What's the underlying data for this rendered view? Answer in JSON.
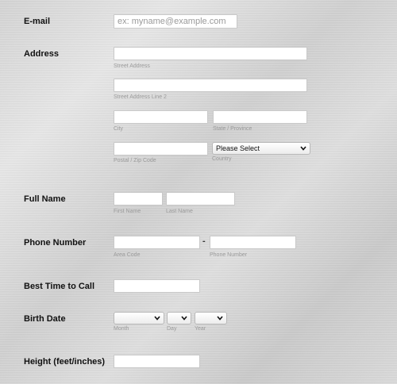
{
  "email": {
    "label": "E-mail",
    "placeholder": "ex: myname@example.com"
  },
  "address": {
    "label": "Address",
    "street_label": "Street Address",
    "street2_label": "Street Address Line 2",
    "city_label": "City",
    "state_label": "State / Province",
    "postal_label": "Postal / Zip Code",
    "country_label": "Country",
    "country_value": "Please Select"
  },
  "full_name": {
    "label": "Full Name",
    "first_label": "First Name",
    "last_label": "Last Name"
  },
  "phone": {
    "label": "Phone Number",
    "separator": "-",
    "area_label": "Area Code",
    "number_label": "Phone Number"
  },
  "best_time": {
    "label": "Best Time to Call"
  },
  "birth_date": {
    "label": "Birth Date",
    "month_label": "Month",
    "day_label": "Day",
    "year_label": "Year"
  },
  "height": {
    "label": "Height (feet/inches)"
  }
}
